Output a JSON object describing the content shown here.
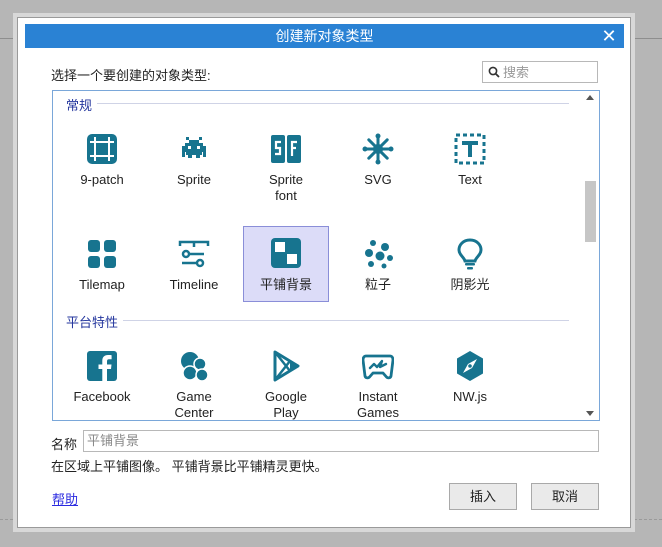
{
  "dialog": {
    "title": "创建新对象类型",
    "close_glyph": "✕",
    "prompt": "选择一个要创建的对象类型:",
    "search": {
      "placeholder": "搜索",
      "value": ""
    }
  },
  "groups": [
    {
      "header": "常规",
      "items": [
        {
          "label": "9-patch",
          "icon": "ninepatch-icon",
          "selected": false
        },
        {
          "label": "Sprite",
          "icon": "sprite-icon",
          "selected": false
        },
        {
          "label": "Sprite\nfont",
          "icon": "sprite-font-icon",
          "selected": false
        },
        {
          "label": "SVG",
          "icon": "svg-icon",
          "selected": false
        },
        {
          "label": "Text",
          "icon": "text-icon",
          "selected": false
        },
        {
          "label": "Tilemap",
          "icon": "tilemap-icon",
          "selected": false
        },
        {
          "label": "Timeline",
          "icon": "timeline-icon",
          "selected": false
        },
        {
          "label": "平铺背景",
          "icon": "tiled-background-icon",
          "selected": true
        },
        {
          "label": "粒子",
          "icon": "particles-icon",
          "selected": false
        },
        {
          "label": "阴影光",
          "icon": "shadow-light-icon",
          "selected": false
        }
      ]
    },
    {
      "header": "平台特性",
      "items": [
        {
          "label": "Facebook",
          "icon": "facebook-icon",
          "selected": false
        },
        {
          "label": "Game\nCenter",
          "icon": "game-center-icon",
          "selected": false
        },
        {
          "label": "Google\nPlay",
          "icon": "google-play-icon",
          "selected": false
        },
        {
          "label": "Instant\nGames",
          "icon": "instant-games-icon",
          "selected": false
        },
        {
          "label": "NW.js",
          "icon": "nwjs-icon",
          "selected": false
        }
      ]
    }
  ],
  "name": {
    "label": "名称",
    "value": "平铺背景"
  },
  "description": "在区域上平铺图像。 平铺背景比平铺精灵更快。",
  "help_link": "帮助",
  "buttons": {
    "insert": "插入",
    "cancel": "取消"
  },
  "colors": {
    "title_bar": "#2a82d4",
    "icon": "#17748f",
    "group_header": "#23359d",
    "selection": "#dcdcf8"
  }
}
